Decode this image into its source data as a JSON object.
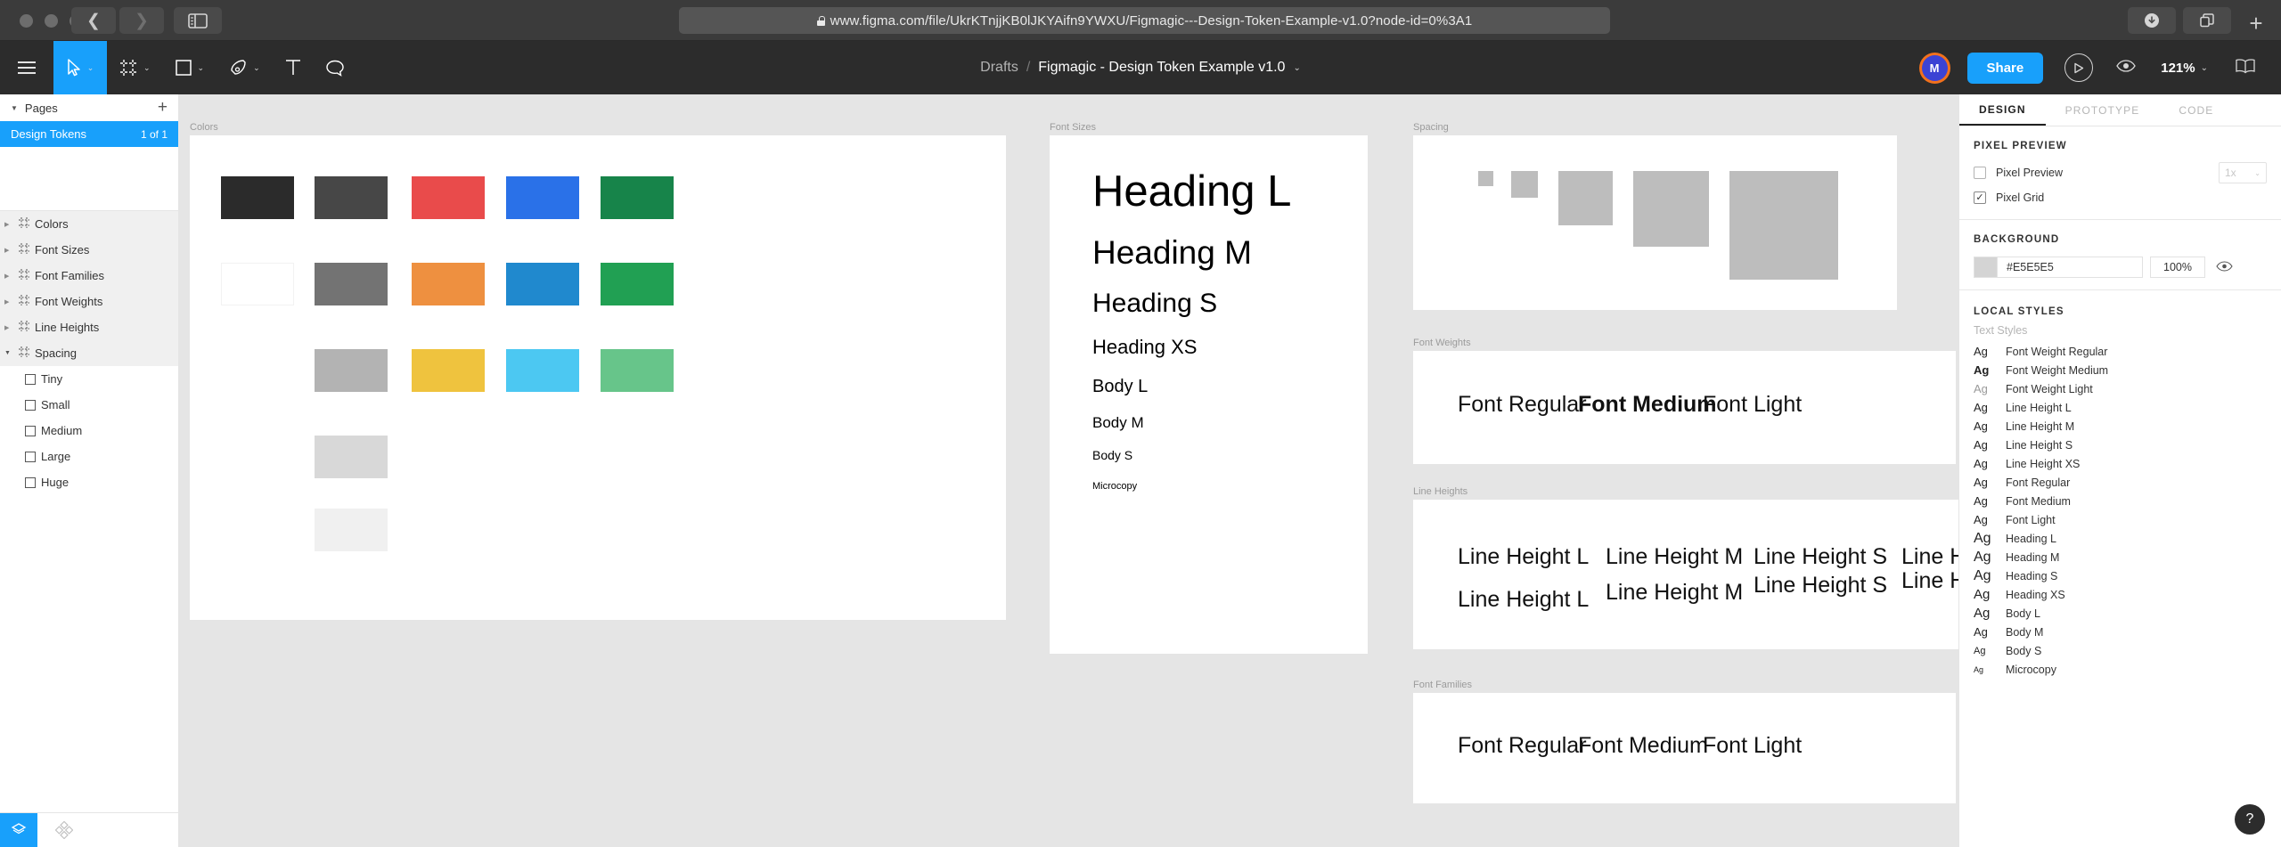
{
  "browser": {
    "url": "www.figma.com/file/UkrKTnjjKB0lJKYAifn9YWXU/Figmagic---Design-Token-Example-v1.0?node-id=0%3A1",
    "back_icon": "chevron-left-icon",
    "forward_icon": "chevron-right-icon",
    "sidebar_icon": "sidebar-toggle-icon",
    "download_icon": "download-icon",
    "share_icon": "share-icon",
    "newtab_icon": "plus-icon"
  },
  "toolbar": {
    "menu_icon": "hamburger-menu-icon",
    "move_icon": "move-cursor-icon",
    "frame_icon": "frame-icon",
    "shape_icon": "rectangle-icon",
    "pen_icon": "pen-icon",
    "text_icon": "text-icon",
    "comment_icon": "comment-icon",
    "caret": "⌄",
    "breadcrumb": {
      "project": "Drafts",
      "separator": "/",
      "file": "Figmagic - Design Token Example v1.0"
    },
    "avatar_initial": "M",
    "share_label": "Share",
    "present_icon": "play-icon",
    "eye_icon": "eye-icon",
    "zoom_level": "121%",
    "book_icon": "book-icon"
  },
  "left_panel": {
    "pages_label": "Pages",
    "add_page_icon": "plus-icon",
    "pages": [
      {
        "name": "Design Tokens",
        "count": "1 of 1",
        "selected": true
      }
    ],
    "layers": [
      {
        "name": "Colors",
        "type": "frame",
        "expanded": false
      },
      {
        "name": "Font Sizes",
        "type": "frame",
        "expanded": false
      },
      {
        "name": "Font Families",
        "type": "frame",
        "expanded": false
      },
      {
        "name": "Font Weights",
        "type": "frame",
        "expanded": false
      },
      {
        "name": "Line Heights",
        "type": "frame",
        "expanded": false
      },
      {
        "name": "Spacing",
        "type": "frame",
        "expanded": true
      }
    ],
    "spacing_children": [
      {
        "name": "Tiny"
      },
      {
        "name": "Small"
      },
      {
        "name": "Medium"
      },
      {
        "name": "Large"
      },
      {
        "name": "Huge"
      }
    ],
    "footer": {
      "layers_icon": "layers-icon",
      "assets_icon": "assets-grid-icon"
    }
  },
  "canvas": {
    "frames": [
      {
        "label": "Colors"
      },
      {
        "label": "Font Sizes"
      },
      {
        "label": "Spacing"
      },
      {
        "label": "Font Weights"
      },
      {
        "label": "Line Heights"
      },
      {
        "label": "Font Families"
      }
    ],
    "colors_swatches": [
      [
        "#2b2b2b",
        "#474747",
        "#e94b4b",
        "#2a71e8",
        "#17844a"
      ],
      [
        "#ffffff",
        "#737373",
        "#ee9040",
        "#2089ce",
        "#21a053"
      ],
      [
        "#b3b3b3",
        "#efc33e",
        "#4cc8f2",
        "#67c58a"
      ],
      [
        "#d8d8d8"
      ],
      [
        "#f0f0f0"
      ]
    ],
    "font_sizes": [
      {
        "label": "Heading L",
        "size": 49
      },
      {
        "label": "Heading M",
        "size": 37
      },
      {
        "label": "Heading S",
        "size": 30
      },
      {
        "label": "Heading XS",
        "size": 22
      },
      {
        "label": "Body L",
        "size": 20
      },
      {
        "label": "Body M",
        "size": 17
      },
      {
        "label": "Body S",
        "size": 14
      },
      {
        "label": "Microcopy",
        "size": 11
      }
    ],
    "spacing_blocks": [
      {
        "name": "Tiny",
        "size": 17
      },
      {
        "name": "Small",
        "size": 30
      },
      {
        "name": "Medium",
        "size": 61
      },
      {
        "name": "Large",
        "size": 85
      },
      {
        "name": "Huge",
        "size": 122
      }
    ],
    "font_weights": [
      {
        "label": "Font Regular",
        "weight": "400"
      },
      {
        "label": "Font Medium",
        "weight": "700"
      },
      {
        "label": "Font Light",
        "weight": "300"
      }
    ],
    "line_heights": [
      {
        "label": "Line Height L",
        "gap": 45
      },
      {
        "label": "Line Height M",
        "gap": 37
      },
      {
        "label": "Line Height S",
        "gap": 29
      },
      {
        "label": "Line Height XS",
        "gap": 24
      }
    ],
    "font_families": [
      {
        "label": "Font Regular"
      },
      {
        "label": "Font Medium"
      },
      {
        "label": "Font Light"
      }
    ]
  },
  "right_panel": {
    "tabs": [
      {
        "label": "DESIGN",
        "active": true
      },
      {
        "label": "PROTOTYPE",
        "active": false
      },
      {
        "label": "CODE",
        "active": false
      }
    ],
    "pixel_preview": {
      "title": "PIXEL PREVIEW",
      "preview_label": "Pixel Preview",
      "preview_checked": false,
      "scale_value": "1x",
      "grid_label": "Pixel Grid",
      "grid_checked": true
    },
    "background": {
      "title": "BACKGROUND",
      "hex": "#E5E5E5",
      "opacity": "100%",
      "eye_icon": "eye-icon"
    },
    "local_styles": {
      "title": "LOCAL STYLES",
      "subtitle": "Text Styles",
      "items": [
        {
          "name": "Font Weight Regular",
          "ag": "Ag",
          "size": 13,
          "weight": "400"
        },
        {
          "name": "Font Weight Medium",
          "ag": "Ag",
          "size": 13,
          "weight": "700"
        },
        {
          "name": "Font Weight Light",
          "ag": "Ag",
          "size": 13,
          "weight": "300"
        },
        {
          "name": "Line Height L",
          "ag": "Ag",
          "size": 13,
          "weight": "400"
        },
        {
          "name": "Line Height M",
          "ag": "Ag",
          "size": 13,
          "weight": "400"
        },
        {
          "name": "Line Height S",
          "ag": "Ag",
          "size": 13,
          "weight": "400"
        },
        {
          "name": "Line Height XS",
          "ag": "Ag",
          "size": 13,
          "weight": "400"
        },
        {
          "name": "Font Regular",
          "ag": "Ag",
          "size": 13,
          "weight": "400"
        },
        {
          "name": "Font Medium",
          "ag": "Ag",
          "size": 13,
          "weight": "400"
        },
        {
          "name": "Font Light",
          "ag": "Ag",
          "size": 13,
          "weight": "400"
        },
        {
          "name": "Heading L",
          "ag": "Ag",
          "size": 16,
          "weight": "400"
        },
        {
          "name": "Heading M",
          "ag": "Ag",
          "size": 16,
          "weight": "400"
        },
        {
          "name": "Heading S",
          "ag": "Ag",
          "size": 16,
          "weight": "400"
        },
        {
          "name": "Heading XS",
          "ag": "Ag",
          "size": 15,
          "weight": "400"
        },
        {
          "name": "Body L",
          "ag": "Ag",
          "size": 15,
          "weight": "400"
        },
        {
          "name": "Body M",
          "ag": "Ag",
          "size": 13,
          "weight": "400"
        },
        {
          "name": "Body S",
          "ag": "Ag",
          "size": 11,
          "weight": "400"
        },
        {
          "name": "Microcopy",
          "ag": "Ag",
          "size": 9,
          "weight": "400"
        }
      ]
    },
    "help_icon": "?"
  }
}
